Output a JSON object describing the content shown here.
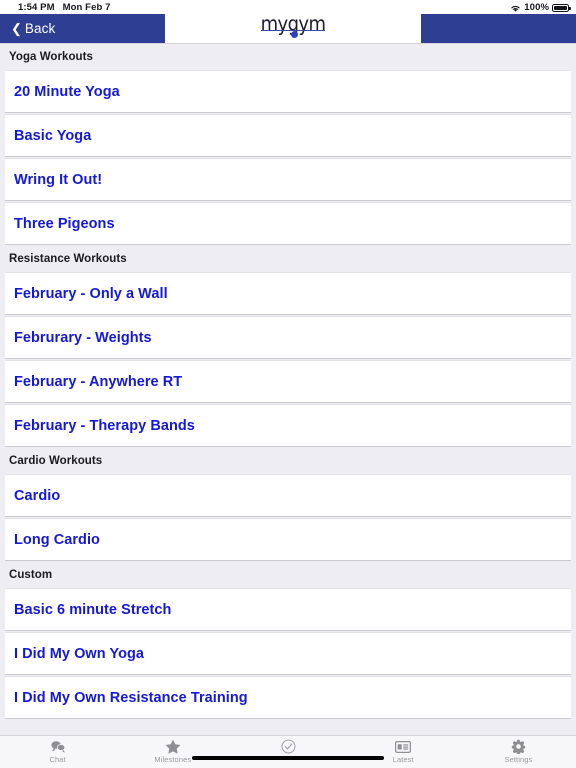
{
  "status_bar": {
    "time": "1:54 PM",
    "date": "Mon Feb 7",
    "wifi_icon": "wifi-icon",
    "battery_percent": "100%",
    "battery_icon": "battery-full-icon"
  },
  "nav_bar": {
    "back_label": "Back",
    "back_chevron_icon": "chevron-left-icon",
    "logo_text": "mygym",
    "logo_accent_color": "#2d40c4",
    "bar_color": "#2e3e93"
  },
  "sections": [
    {
      "title": "Yoga Workouts",
      "items": [
        {
          "label": "20 Minute Yoga"
        },
        {
          "label": "Basic Yoga"
        },
        {
          "label": "Wring It Out!"
        },
        {
          "label": "Three Pigeons"
        }
      ]
    },
    {
      "title": "Resistance Workouts",
      "items": [
        {
          "label": "February - Only a Wall"
        },
        {
          "label": "Februrary - Weights"
        },
        {
          "label": "February - Anywhere RT"
        },
        {
          "label": "February - Therapy Bands"
        }
      ]
    },
    {
      "title": "Cardio Workouts",
      "items": [
        {
          "label": "Cardio"
        },
        {
          "label": "Long Cardio"
        }
      ]
    },
    {
      "title": "Custom",
      "items": [
        {
          "label": "Basic 6 minute Stretch"
        },
        {
          "label": "I Did My Own Yoga"
        },
        {
          "label": "I Did My Own Resistance Training"
        }
      ]
    }
  ],
  "tab_bar": {
    "tabs": [
      {
        "label": "Chat",
        "icon": "chat-bubbles-icon"
      },
      {
        "label": "Milestones",
        "icon": "star-icon"
      },
      {
        "label": "",
        "icon": "check-circle-icon"
      },
      {
        "label": "Latest",
        "icon": "news-card-icon"
      },
      {
        "label": "Settings",
        "icon": "gear-icon"
      }
    ]
  },
  "colors": {
    "link_blue": "#1418d8",
    "nav_blue": "#2e3e93",
    "page_bg": "#eeeef2"
  }
}
